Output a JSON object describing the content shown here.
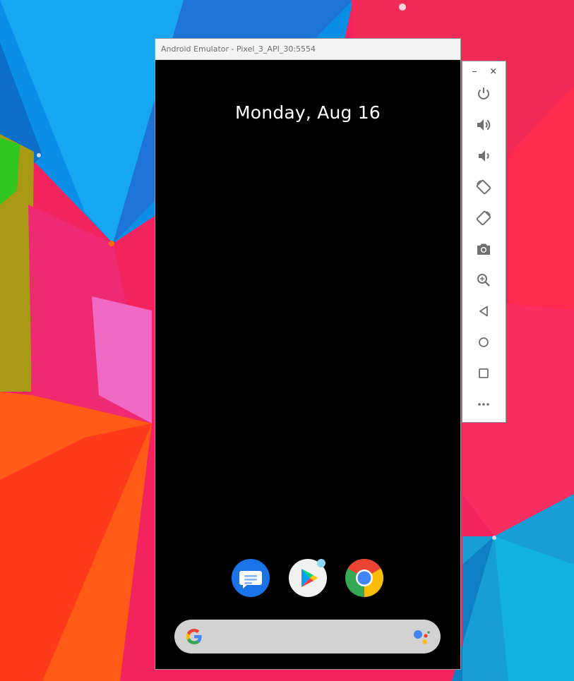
{
  "window": {
    "title": "Android Emulator - Pixel_3_API_30:5554"
  },
  "lockscreen": {
    "date": "Monday, Aug 16"
  },
  "dock": {
    "apps": [
      {
        "name": "Messages",
        "icon": "messages-icon",
        "color": "#1a73e8"
      },
      {
        "name": "Play Store",
        "icon": "play-store-icon",
        "color": "#f1f1f1",
        "notification_dot": true
      },
      {
        "name": "Chrome",
        "icon": "chrome-icon",
        "color": "#4285f4"
      }
    ]
  },
  "search_bar": {
    "logo": "google-g-icon",
    "assistant": "google-assistant-icon",
    "background": "#d2d2d2"
  },
  "toolbar": {
    "window_controls": [
      "minimize-icon",
      "close-icon"
    ],
    "buttons": [
      "power-icon",
      "volume-up-icon",
      "volume-down-icon",
      "rotate-left-icon",
      "rotate-right-icon",
      "camera-icon",
      "zoom-icon",
      "back-icon",
      "home-icon",
      "overview-icon",
      "more-icon"
    ],
    "icon_color": "#707070"
  },
  "colors": {
    "screen": "#000000",
    "title_bar": "#f3f3f3",
    "accent_blue": "#4285f4",
    "accent_red": "#ea4335",
    "accent_yellow": "#fbbc05",
    "accent_green": "#34a853"
  }
}
